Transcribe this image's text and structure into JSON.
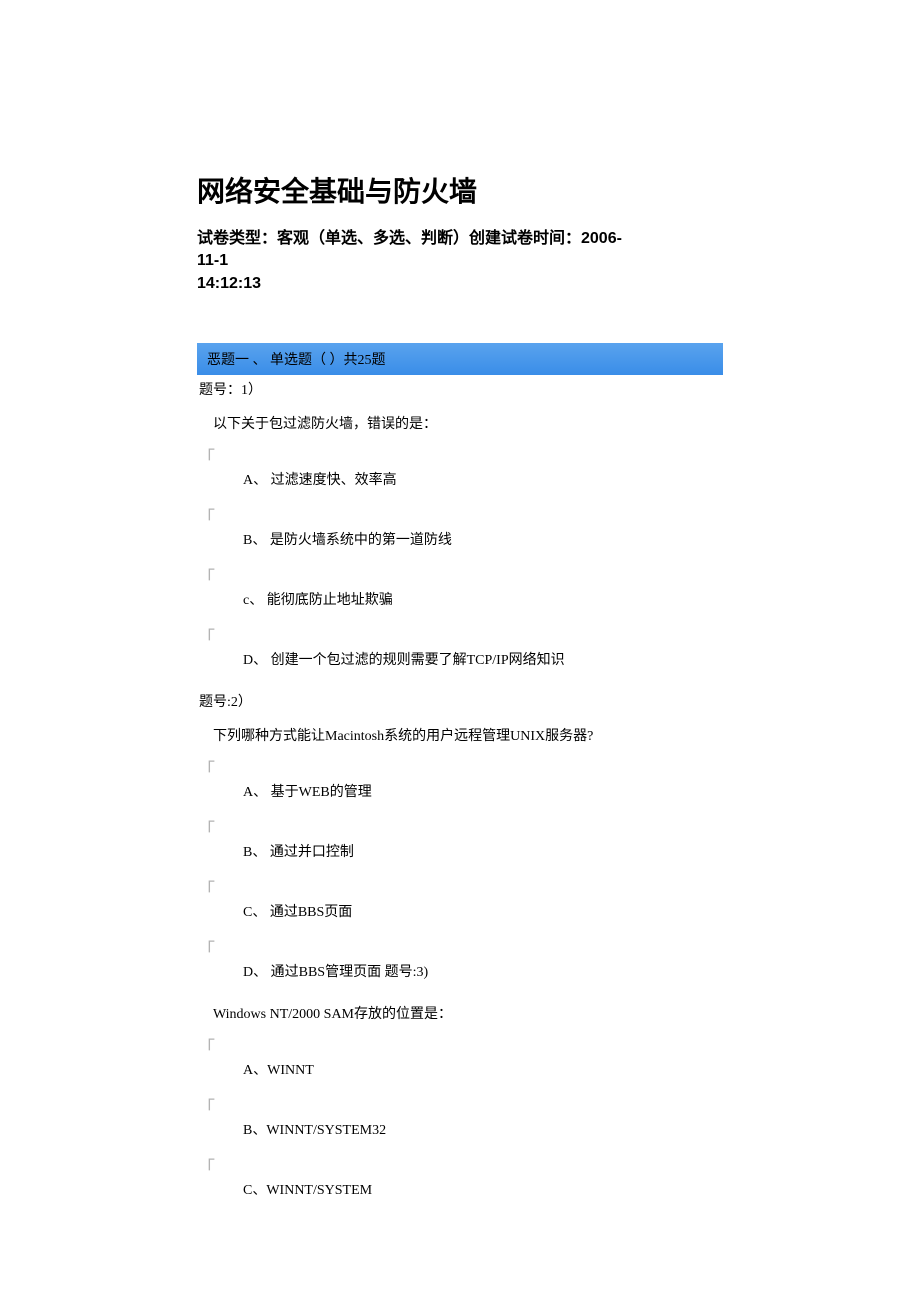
{
  "title": "网络安全基础与防火墙",
  "meta_line1": "试卷类型：客观（单选、多选、判断）创建试卷时间：2006-",
  "meta_line2": "11-1",
  "meta_line3": "14:12:13",
  "section_header": "恶题一 、 单选题（ ）共25题",
  "q1": {
    "num": "题号：1）",
    "stem": "以下关于包过滤防火墙，错误的是：",
    "optA": "A、 过滤速度快、效率高",
    "optB": "B、 是防火墙系统中的第一道防线",
    "optC": "c、 能彻底防止地址欺骗",
    "optD": "D、 创建一个包过滤的规则需要了解TCP/IP网络知识"
  },
  "q2": {
    "num": "题号:2）",
    "stem": "下列哪种方式能让Macintosh系统的用户远程管理UNIX服务器?",
    "optA": "A、 基于WEB的管理",
    "optB": "B、 通过并口控制",
    "optC": "C、 通过BBS页面",
    "optD": "D、    通过BBS管理页面  题号:3)"
  },
  "q3": {
    "stem": "Windows NT/2000 SAM存放的位置是：",
    "optA": "A、WINNT",
    "optB": "B、WINNT/SYSTEM32",
    "optC": "C、WINNT/SYSTEM"
  },
  "marker": "「"
}
